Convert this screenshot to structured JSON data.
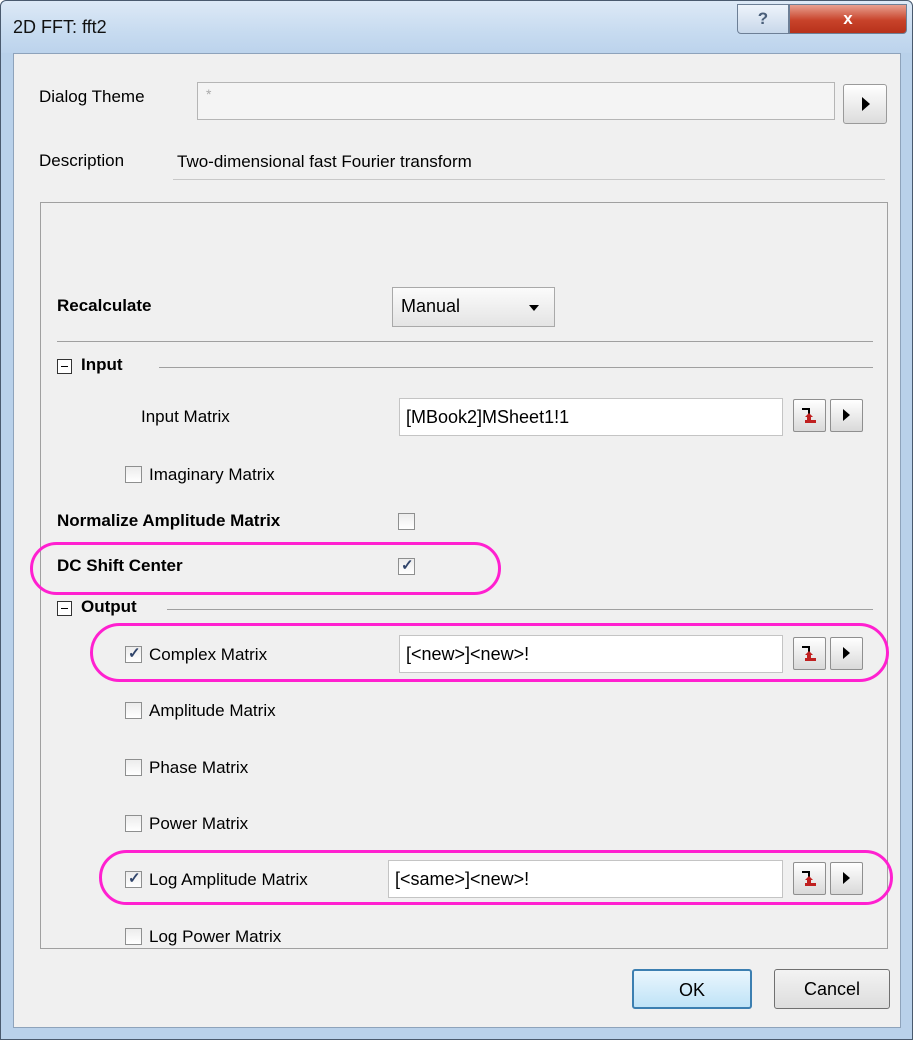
{
  "window": {
    "title": "2D FFT: fft2",
    "help_glyph": "?",
    "close_glyph": "x"
  },
  "dialog_theme": {
    "label": "Dialog Theme",
    "value": "*"
  },
  "description": {
    "label": "Description",
    "value": "Two-dimensional fast Fourier transform"
  },
  "recalculate": {
    "label": "Recalculate",
    "value": "Manual"
  },
  "input": {
    "header": "Input",
    "input_matrix": {
      "label": "Input Matrix",
      "value": "[MBook2]MSheet1!1"
    },
    "imaginary_matrix": {
      "label": "Imaginary Matrix",
      "checked": false
    }
  },
  "normalize": {
    "label": "Normalize Amplitude Matrix",
    "checked": false
  },
  "dc_shift": {
    "label": "DC Shift Center",
    "checked": true
  },
  "output": {
    "header": "Output",
    "complex_matrix": {
      "label": "Complex Matrix",
      "checked": true,
      "value": "[<new>]<new>!"
    },
    "amplitude_matrix": {
      "label": "Amplitude Matrix",
      "checked": false
    },
    "phase_matrix": {
      "label": "Phase Matrix",
      "checked": false
    },
    "power_matrix": {
      "label": "Power Matrix",
      "checked": false
    },
    "log_amplitude_matrix": {
      "label": "Log Amplitude Matrix",
      "checked": true,
      "value": "[<same>]<new>!"
    },
    "log_power_matrix": {
      "label": "Log Power Matrix",
      "checked": false
    }
  },
  "buttons": {
    "ok": "OK",
    "cancel": "Cancel"
  },
  "colors": {
    "highlight": "#ff20d0",
    "window_frame": "#b9d1ea",
    "close_button": "#c8432a"
  }
}
